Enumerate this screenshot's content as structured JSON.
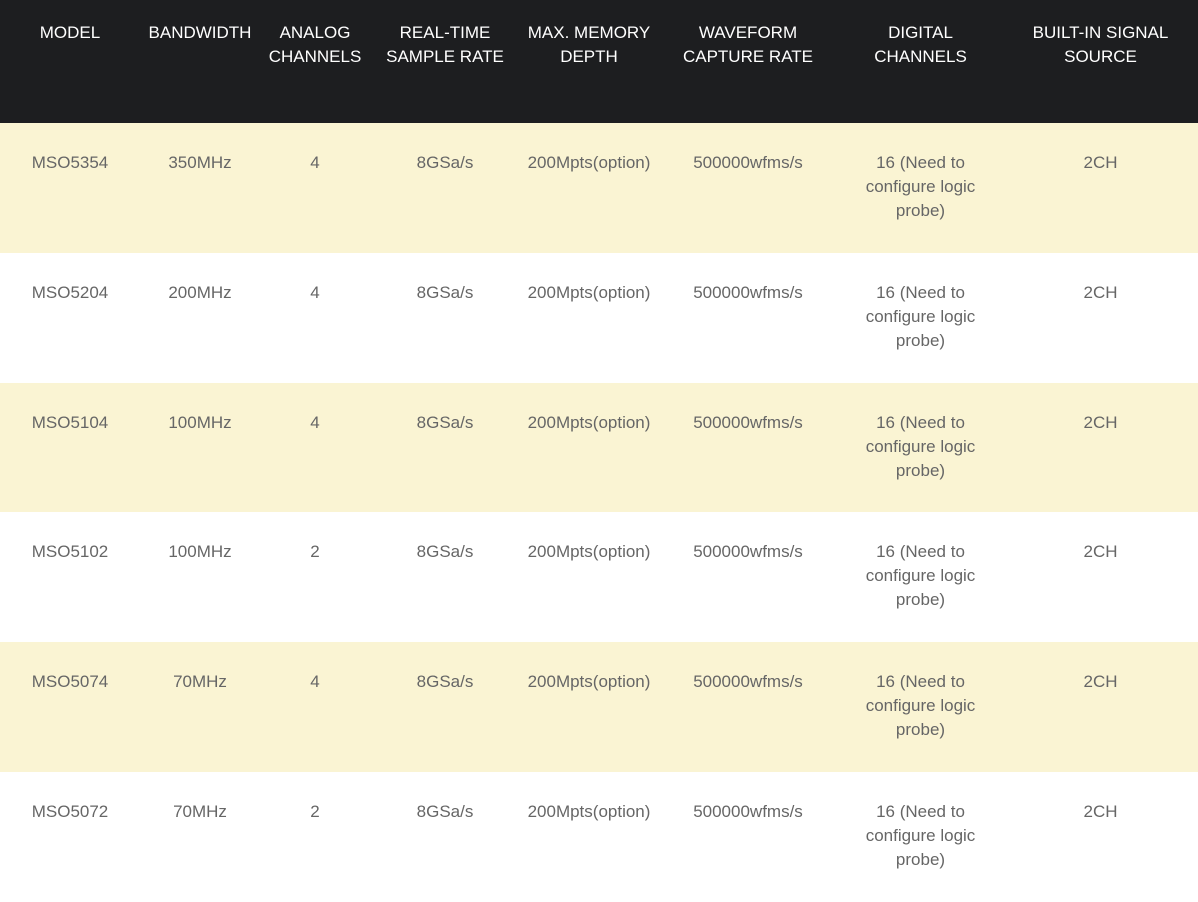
{
  "table": {
    "headers": [
      "MODEL",
      "BANDWIDTH",
      "ANALOG CHANNELS",
      "REAL-TIME SAMPLE RATE",
      "MAX. MEMORY DEPTH",
      "WAVEFORM CAPTURE RATE",
      "DIGITAL CHANNELS",
      "BUILT-IN SIGNAL SOURCE"
    ],
    "rows": [
      [
        "MSO5354",
        "350MHz",
        "4",
        "8GSa/s",
        "200Mpts(option)",
        "500000wfms/s",
        "16 (Need to configure logic probe)",
        "2CH"
      ],
      [
        "MSO5204",
        "200MHz",
        "4",
        "8GSa/s",
        "200Mpts(option)",
        "500000wfms/s",
        "16 (Need to configure logic probe)",
        "2CH"
      ],
      [
        "MSO5104",
        "100MHz",
        "4",
        "8GSa/s",
        "200Mpts(option)",
        "500000wfms/s",
        "16 (Need to configure logic probe)",
        "2CH"
      ],
      [
        "MSO5102",
        "100MHz",
        "2",
        "8GSa/s",
        "200Mpts(option)",
        "500000wfms/s",
        "16 (Need to configure logic probe)",
        "2CH"
      ],
      [
        "MSO5074",
        "70MHz",
        "4",
        "8GSa/s",
        "200Mpts(option)",
        "500000wfms/s",
        "16 (Need to configure logic probe)",
        "2CH"
      ],
      [
        "MSO5072",
        "70MHz",
        "2",
        "8GSa/s",
        "200Mpts(option)",
        "500000wfms/s",
        "16 (Need to configure logic probe)",
        "2CH"
      ]
    ]
  },
  "colors": {
    "header_bg": "#1d1e20",
    "header_text": "#ffffff",
    "row_alt_bg": "#faf4d3",
    "row_bg": "#ffffff",
    "cell_text": "#666666"
  }
}
